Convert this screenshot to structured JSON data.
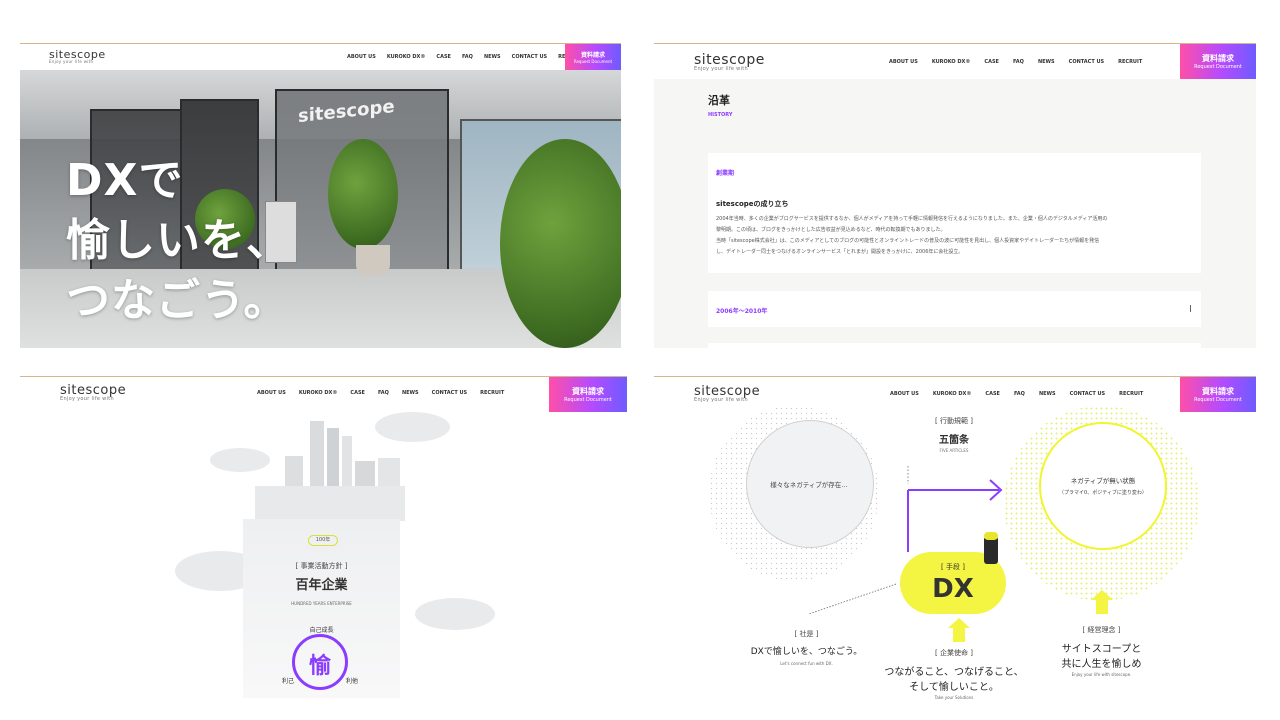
{
  "brand": {
    "logo": "sitescope",
    "tagline": "Enjoy your life with"
  },
  "nav": [
    "ABOUT US",
    "KUROKO DX®",
    "CASE",
    "FAQ",
    "NEWS",
    "CONTACT US",
    "RECRUIT"
  ],
  "cta": {
    "label": "資料請求",
    "sub": "Request Document"
  },
  "panel1": {
    "sign": "sitescope",
    "hero_lines": [
      "DXで",
      "愉しいを、",
      "つなごう。"
    ]
  },
  "panel2": {
    "title": "沿革",
    "title_sub": "HISTORY",
    "era1": "創業期",
    "card_title": "sitescopeの成り立ち",
    "card_lines": [
      "2004年当時、多くの企業がブログサービスを提供するなか、個人がメディアを持って手軽に情報発信を行えるようになりました。また、企業・個人のデジタルメディア活用の",
      "黎明期。この頃は、ブログをきっかけとした広告収益が見込めるなど、時代の転換期でもありました。",
      "当時「sitescope株式会社」は、このメディアとしてのブログの可能性とオンライントレードの普及の波に可能性を見出し、個人投資家やデイトレーダーたちが情報を発信",
      "し、デイトレーダー同士をつなげるオンラインサービス「とれまが」開設をきっかけに、2006年に会社設立。"
    ],
    "era2": "2006年〜2010年"
  },
  "panel3": {
    "badge": "100年",
    "bracket": "[ 事業活動方針 ]",
    "title": "百年企業",
    "title_en": "HUNDRED YEARS ENTERPRISE",
    "growth": "自己成長",
    "center": "愉",
    "left": "利己",
    "right": "利他"
  },
  "panel4": {
    "rules_bracket": "[ 行動規範 ]",
    "rules_title": "五箇条",
    "rules_en": "FIVE ARTICLES",
    "left_circle": "様々なネガティブが存在…",
    "right_circle": "ネガティブが無い状態",
    "right_circle_sub": "（プラマイ0、ポジティブに塗り変わ）",
    "means_bracket": "[ 手段 ]",
    "means_title": "DX",
    "motto_bracket": "[ 社是 ]",
    "motto": "DXで愉しいを、つなごう。",
    "motto_en": "Let's connect fun with DX.",
    "mission_bracket": "[ 企業使命 ]",
    "mission_line1": "つながること、つなげること、",
    "mission_line2": "そして愉しいこと。",
    "mission_en": "Take your Solutions",
    "vision_bracket": "[ 経営理念 ]",
    "vision_line1": "サイトスコープと",
    "vision_line2": "共に人生を愉しめ",
    "vision_en": "Enjoy your life with sitescope."
  },
  "colors": {
    "accent": "#8a3cff",
    "yellow": "#f4f542",
    "cta_from": "#ff4fa8",
    "cta_to": "#6e5bff"
  }
}
